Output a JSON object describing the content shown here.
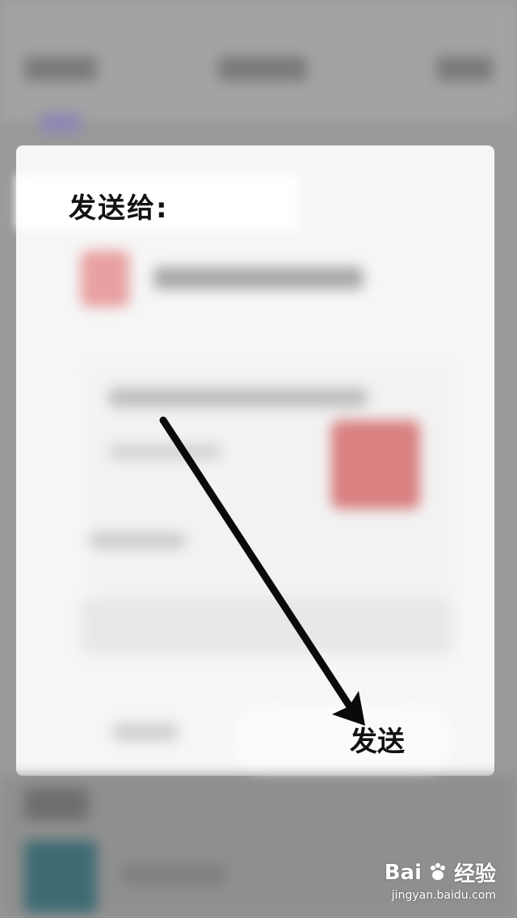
{
  "dialog": {
    "send_to_label": "发送给:",
    "send_button_label": "发送"
  },
  "watermark": {
    "brand_left": "Bai",
    "brand_right": "经验",
    "url": "jingyan.baidu.com"
  },
  "colors": {
    "accent_pink": "#e79a9a",
    "lower_teal": "#3e6b73",
    "purple_bg": "#8d86b6"
  }
}
